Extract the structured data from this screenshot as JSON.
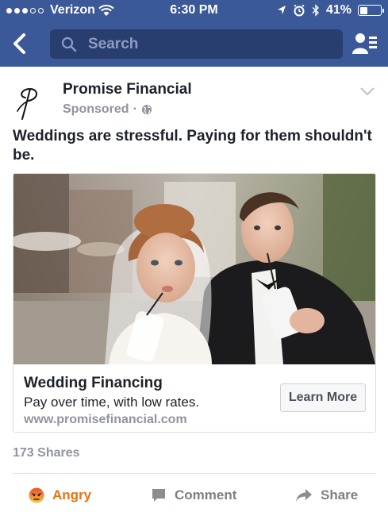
{
  "status_bar": {
    "carrier": "Verizon",
    "time": "6:30 PM",
    "battery": "41%",
    "battery_level": 0.41
  },
  "header": {
    "search_placeholder": "Search"
  },
  "post": {
    "page_name": "Promise Financial",
    "sponsored_label": "Sponsored",
    "message": "Weddings are stressful. Paying for them shouldn't be.",
    "ad": {
      "headline": "Wedding Financing",
      "description": "Pay over time, with low rates.",
      "url": "www.promisefinancial.com",
      "cta_label": "Learn More"
    },
    "shares_text": "173 Shares",
    "actions": {
      "reaction_label": "Angry",
      "comment_label": "Comment",
      "share_label": "Share"
    }
  },
  "colors": {
    "header_blue": "#3b5998",
    "search_bg": "#283e6f",
    "angry_orange": "#e9710f",
    "muted_gray": "#90949c"
  },
  "icons": [
    "wifi-icon",
    "location-arrow-icon",
    "alarm-icon",
    "bluetooth-icon",
    "battery-icon",
    "back-arrow-icon",
    "search-icon",
    "friend-requests-icon",
    "promise-financial-logo",
    "globe-icon",
    "chevron-down-icon",
    "angry-face-icon",
    "comment-icon",
    "share-arrow-icon"
  ]
}
